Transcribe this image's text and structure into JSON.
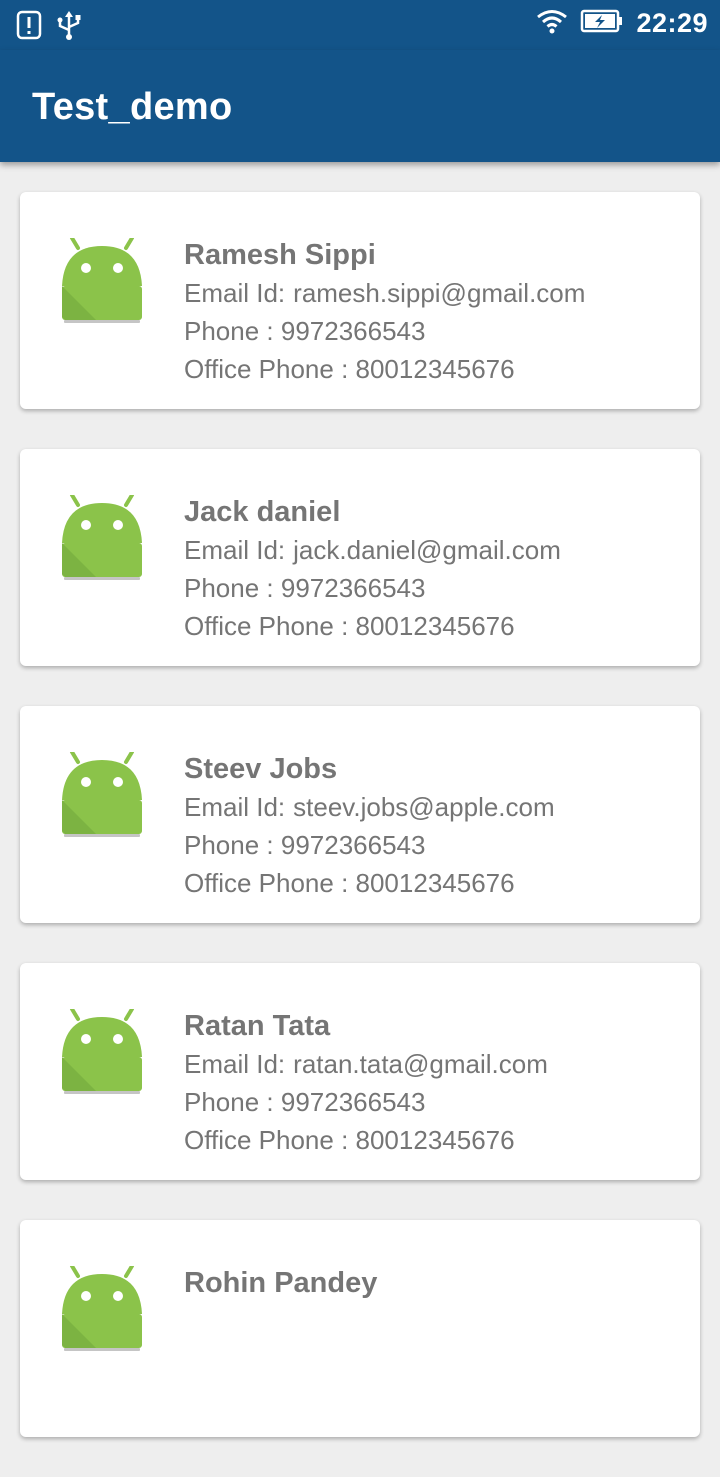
{
  "status_bar": {
    "time": "22:29"
  },
  "app_bar": {
    "title": "Test_demo"
  },
  "contacts": [
    {
      "name": "Ramesh Sippi",
      "email_label": "Email Id:",
      "email": "ramesh.sippi@gmail.com",
      "phone": "Phone : 9972366543",
      "office_phone": "Office Phone : 80012345676"
    },
    {
      "name": "Jack daniel",
      "email_label": "Email Id:",
      "email": "jack.daniel@gmail.com",
      "phone": "Phone : 9972366543",
      "office_phone": "Office Phone : 80012345676"
    },
    {
      "name": "Steev Jobs",
      "email_label": "Email Id:",
      "email": "steev.jobs@apple.com",
      "phone": "Phone : 9972366543",
      "office_phone": "Office Phone : 80012345676"
    },
    {
      "name": "Ratan Tata",
      "email_label": "Email Id:",
      "email": "ratan.tata@gmail.com",
      "phone": "Phone : 9972366543",
      "office_phone": "Office Phone : 80012345676"
    },
    {
      "name": "Rohin Pandey",
      "email_label": "",
      "email": "",
      "phone": "",
      "office_phone": ""
    }
  ],
  "colors": {
    "primary": "#135489",
    "background": "#eeeeee",
    "text": "#757575",
    "android_green": "#8bc34a"
  },
  "icons": {
    "status_left": [
      "alert-icon",
      "usb-icon"
    ],
    "status_right": [
      "wifi-icon",
      "battery-charging-icon"
    ],
    "avatar": "android-icon"
  }
}
